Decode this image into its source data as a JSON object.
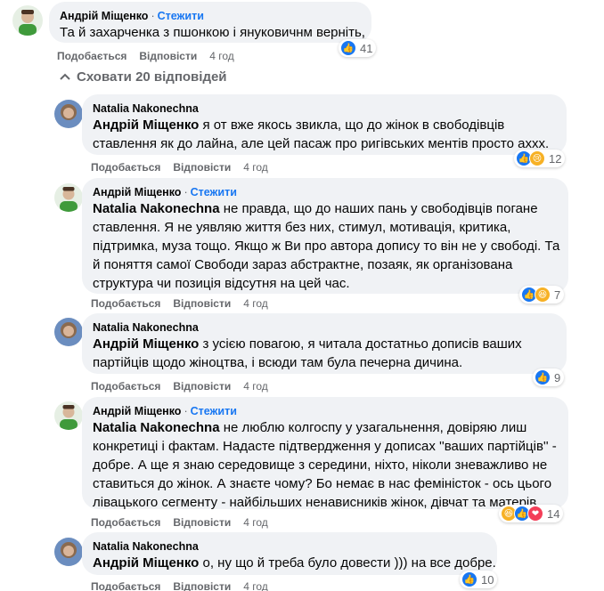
{
  "comments": [
    {
      "author": "Андрій Міщенко",
      "follow": "Стежити",
      "mention": "",
      "lines": [
        "Та й захарченка з пшонкою і януковичнм верніть,"
      ],
      "like": "Подобається",
      "reply": "Відповісти",
      "time": "4 год",
      "count": "41"
    },
    {
      "author": "Natalia Nakonechna",
      "follow": "",
      "mention": "Андрій Міщенко",
      "lines": [
        "я от вже якось звикла, що до жінок в свободівців",
        "ставлення як до лайна, але цей пасаж про ригівських ментів просто аххх."
      ],
      "like": "Подобається",
      "reply": "Відповісти",
      "time": "4 год",
      "count": "12"
    },
    {
      "author": "Андрій Міщенко",
      "follow": "Стежити",
      "mention": "Natalia Nakonechna",
      "lines": [
        "не правда, що до наших пань у свободівців погане",
        "ставлення. Я не уявляю життя без них, стимул, мотивація, критика,",
        "підтримка, муза тощо. Якщо ж Ви про автора допису то він не у свободі. Та",
        "й поняття самої Свободи зараз абстрактне, позаяк, як організована",
        "структура чи позиція відсутня на цей час."
      ],
      "like": "Подобається",
      "reply": "Відповісти",
      "time": "4 год",
      "count": "7"
    },
    {
      "author": "Natalia Nakonechna",
      "follow": "",
      "mention": "Андрій Міщенко",
      "lines": [
        "з усією повагою, я читала достатньо дописів ваших",
        "партійців щодо жіноцтва, і всюди там була печерна дичина."
      ],
      "like": "Подобається",
      "reply": "Відповісти",
      "time": "4 год",
      "count": "9"
    },
    {
      "author": "Андрій Міщенко",
      "follow": "Стежити",
      "mention": "Natalia Nakonechna",
      "lines": [
        "не люблю колгоспу у узагальнення, довіряю лиш",
        "конкретиці і фактам. Надасте підтвердження у дописах ''ваших партійців'' -",
        "добре. А ще я знаю середовище з середини, ніхто, ніколи зневажливо не",
        "ставиться до жінок. А знаєте чому? Бо немає в нас феміністок - ось цього",
        "лівацького сегменту - найбільших ненависників жінок, дівчат та матерів"
      ],
      "like": "Подобається",
      "reply": "Відповісти",
      "time": "4 год",
      "count": "14"
    },
    {
      "author": "Natalia Nakonechna",
      "follow": "",
      "mention": "Андрій Міщенко",
      "lines": [
        "о, ну що й треба було довести ))) на все добре."
      ],
      "like": "Подобається",
      "reply": "Відповісти",
      "time": "4 год",
      "count": "10"
    }
  ],
  "replies_toggle": "Сховати 20 відповідей",
  "colors": {
    "bubble": "#f0f2f5",
    "link": "#1877f2",
    "muted": "#65676b",
    "like": "#1877f2",
    "love": "#f33e58",
    "emoji": "#f7b125"
  }
}
